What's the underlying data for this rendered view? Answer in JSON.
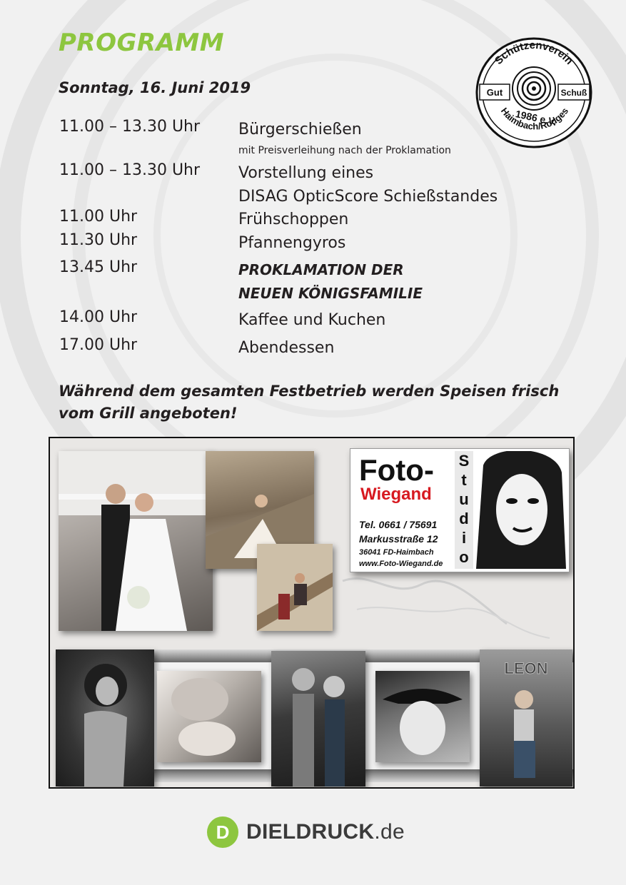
{
  "page": {
    "title": "PROGRAMM",
    "date": "Sonntag, 16. Juni 2019",
    "accent_color": "#8dc63f"
  },
  "logo": {
    "text_top": "Schützenverein",
    "text_left": "Gut",
    "text_right": "Schuß",
    "text_year": "1986 e.V.",
    "text_bottom": "Haimbach/Rodges"
  },
  "schedule": [
    {
      "time": "11.00 – 13.30 Uhr",
      "event": [
        "Bürgerschießen"
      ],
      "note": "mit Preisverleihung nach der Proklamation"
    },
    {
      "time": "11.00 – 13.30 Uhr",
      "event": [
        "Vorstellung eines",
        "DISAG OpticScore Schießstandes"
      ]
    },
    {
      "time": "11.00 Uhr",
      "event": [
        "Frühschoppen"
      ]
    },
    {
      "time": "11.30 Uhr",
      "event": [
        "Pfannengyros"
      ]
    },
    {
      "time": "13.45 Uhr",
      "event": [
        "PROKLAMATION DER",
        "NEUEN KÖNIGSFAMILIE"
      ],
      "highlight": true
    },
    {
      "time": "14.00 Uhr",
      "event": [
        "Kaffee und Kuchen"
      ]
    },
    {
      "time": "17.00 Uhr",
      "event": [
        "Abendessen"
      ]
    }
  ],
  "note": {
    "line1": "Während dem gesamten Festbetrieb werden Speisen frisch",
    "line2": "vom Grill angeboten!"
  },
  "ad": {
    "brand_top": "Foto-",
    "brand_bottom": "Wiegand",
    "studio_letters": [
      "S",
      "t",
      "u",
      "d",
      "i",
      "o"
    ],
    "phone": "Tel. 0661 / 75691",
    "street": "Markusstraße 12",
    "city": "36041 FD-Haimbach",
    "web": "www.Foto-Wiegand.de",
    "poster_text": "LEON",
    "brand_color": "#d71920"
  },
  "footer": {
    "brand": "DIELDRUCK",
    "tld": ".de",
    "icon_letter": "D",
    "icon_color": "#8dc63f"
  }
}
